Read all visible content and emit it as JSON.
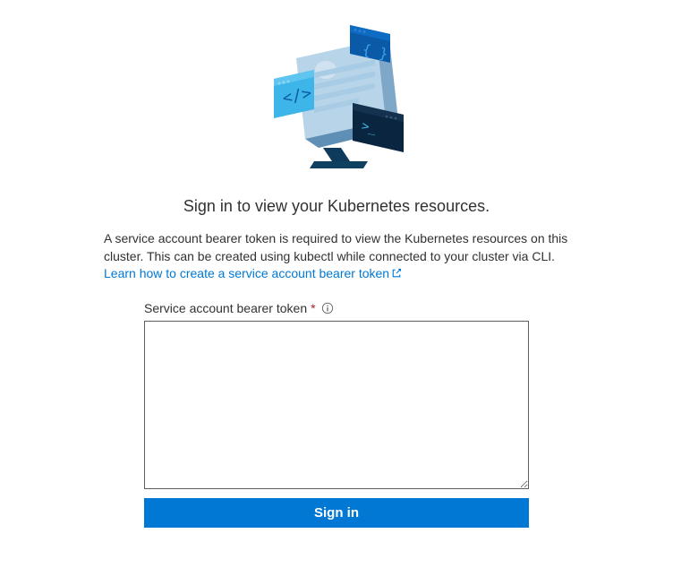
{
  "heading": "Sign in to view your Kubernetes resources.",
  "description_text": "A service account bearer token is required to view the Kubernetes resources on this cluster. This can be created using kubectl while connected to your cluster via CLI. ",
  "description_link": "Learn how to create a service account bearer token",
  "form": {
    "label": "Service account bearer token",
    "required_mark": "*",
    "value": "",
    "placeholder": ""
  },
  "button_label": "Sign in"
}
